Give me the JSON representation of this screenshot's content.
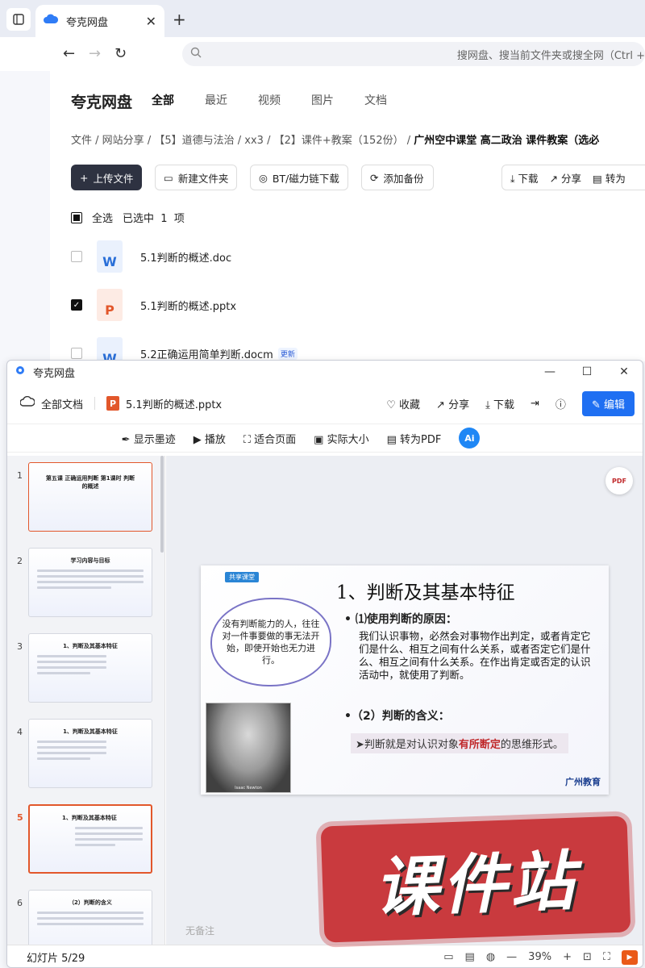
{
  "browser": {
    "tab_title": "夸克网盘",
    "url_hint": "搜网盘、搜当前文件夹或搜全网（Ctrl +"
  },
  "quark": {
    "brand": "夸克网盘",
    "nav": [
      "全部",
      "最近",
      "视频",
      "图片",
      "文档"
    ],
    "breadcrumb": [
      "文件",
      "网站分享",
      "【5】道德与法治",
      "xx3",
      "【2】课件+教案（152份）"
    ],
    "breadcrumb_current": "广州空中课堂 高二政治 课件教案（选必",
    "toolbar": {
      "upload": "上传文件",
      "new_folder": "新建文件夹",
      "bt": "BT/磁力链下载",
      "backup": "添加备份",
      "download": "下载",
      "share": "分享",
      "convert": "转为"
    },
    "select_all": "全选",
    "selected_prefix": "已选中",
    "selected_count": "1",
    "selected_suffix": "项",
    "files": [
      {
        "name": "5.1判断的概述.doc",
        "type": "word",
        "checked": false
      },
      {
        "name": "5.1判断的概述.pptx",
        "type": "ppt",
        "checked": true
      },
      {
        "name": "5.2正确运用简单判断.docm",
        "type": "word",
        "checked": false,
        "badge": "更新"
      }
    ]
  },
  "viewer": {
    "window_title": "夸克网盘",
    "all_docs": "全部文档",
    "file_name": "5.1判断的概述.pptx",
    "actions": {
      "collect": "收藏",
      "share": "分享",
      "download": "下载",
      "edit": "编辑"
    },
    "tools": {
      "ink": "显示墨迹",
      "play": "播放",
      "fit": "适合页面",
      "actual": "实际大小",
      "to_pdf": "转为PDF",
      "ai": "Ai"
    },
    "thumbnails": [
      {
        "num": "1",
        "title": "第五课 正确运用判断 第1课时 判断的概述"
      },
      {
        "num": "2",
        "title": "学习内容与目标"
      },
      {
        "num": "3",
        "title": "1、判断及其基本特征"
      },
      {
        "num": "4",
        "title": "1、判断及其基本特征"
      },
      {
        "num": "5",
        "title": "1、判断及其基本特征"
      },
      {
        "num": "6",
        "title": "（2）判断的含义"
      }
    ],
    "slide": {
      "tag": "共享课堂",
      "title": "1、判断及其基本特征",
      "cloud_text": "没有判断能力的人，往往对一件事要做的事无法开始，即使开始也无力进行。",
      "portrait_caption": "Isaac Newton",
      "bullet1": "• ⑴使用判断的原因：",
      "body": "我们认识事物，必然会对事物作出判定，或者肯定它们是什么、相互之间有什么关系，或者否定它们是什么、相互之间有什么关系。在作出肯定或否定的认识活动中，就使用了判断。",
      "bullet2": "•（2）判断的含义：",
      "def_pre": "➤判断就是对认识对象",
      "def_em": "有所断定",
      "def_post": "的思维形式。",
      "logo": "广州教育"
    },
    "notes": "无备注",
    "status": {
      "slide_label": "幻灯片 5/29",
      "zoom": "39%"
    }
  },
  "watermark": "课件站"
}
